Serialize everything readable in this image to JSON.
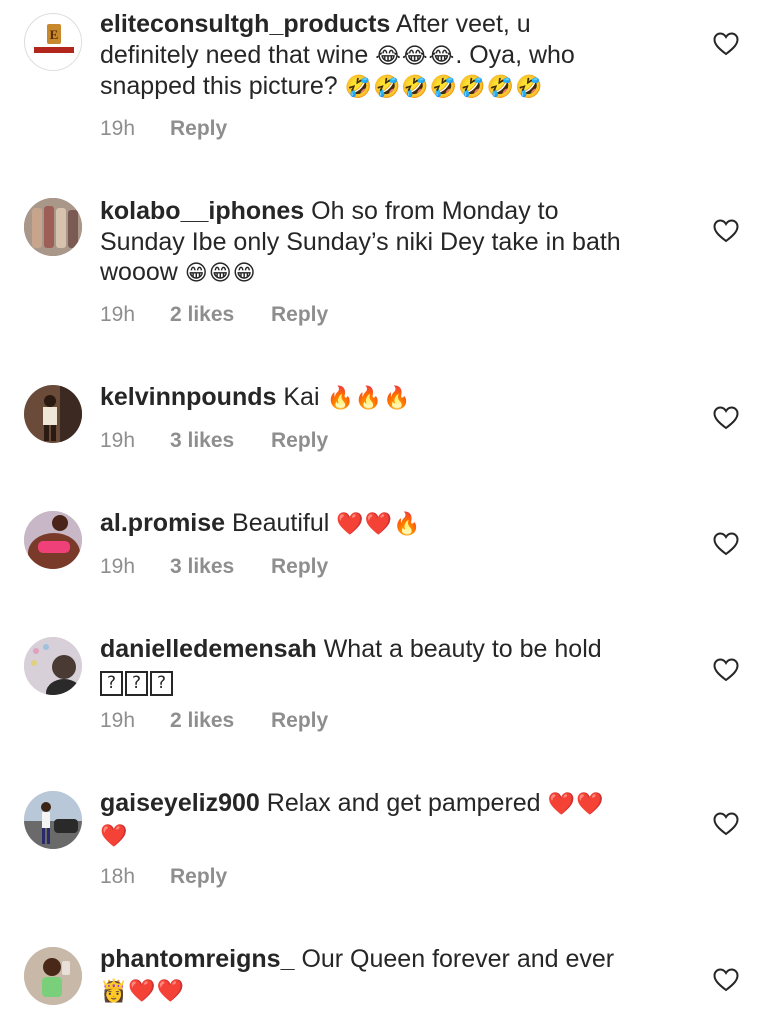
{
  "comments": [
    {
      "username": "eliteconsultgh_products",
      "text_lines": [
        "After veet, u",
        "definitely need that wine",
        "snapped this picture?"
      ],
      "emoji_inline": [
        "😂😂😂",
        ". Oya, who",
        "🤣🤣🤣🤣🤣🤣🤣"
      ],
      "time": "19h",
      "likes": "",
      "reply": "Reply",
      "avatar": "logo-avatar"
    },
    {
      "username": "kolabo__iphones",
      "text": "Oh so from Monday to Sunday Ibe only Sunday’s niki Dey take in bath",
      "line1": "Oh so from Monday to",
      "line2": "Sunday Ibe only Sunday’s niki Dey take in bath",
      "line3": "wooow",
      "emoji": "😁😁😁",
      "time": "19h",
      "likes": "2 likes",
      "reply": "Reply"
    },
    {
      "username": "kelvinnpounds",
      "text": "Kai",
      "emoji": "🔥🔥🔥",
      "time": "19h",
      "likes": "3 likes",
      "reply": "Reply"
    },
    {
      "username": "al.promise",
      "text": "Beautiful",
      "emoji": "❤️❤️🔥",
      "time": "19h",
      "likes": "3 likes",
      "reply": "Reply"
    },
    {
      "username": "danielledemensah",
      "text": "What a beauty to be hold",
      "emoji": "???",
      "time": "19h",
      "likes": "2 likes",
      "reply": "Reply"
    },
    {
      "username": "gaiseyeliz900",
      "text": "Relax and get pampered",
      "emoji": "❤️❤️",
      "emoji2": "❤️",
      "time": "18h",
      "likes": "",
      "reply": "Reply"
    },
    {
      "username": "phantomreigns_",
      "text": "Our Queen forever and ever",
      "emoji": "👸❤️❤️"
    }
  ],
  "icons": {
    "like": "heart-outline-icon"
  },
  "colors": {
    "meta": "#8e8e8e",
    "text": "#262626",
    "heart_stroke": "#262626"
  }
}
